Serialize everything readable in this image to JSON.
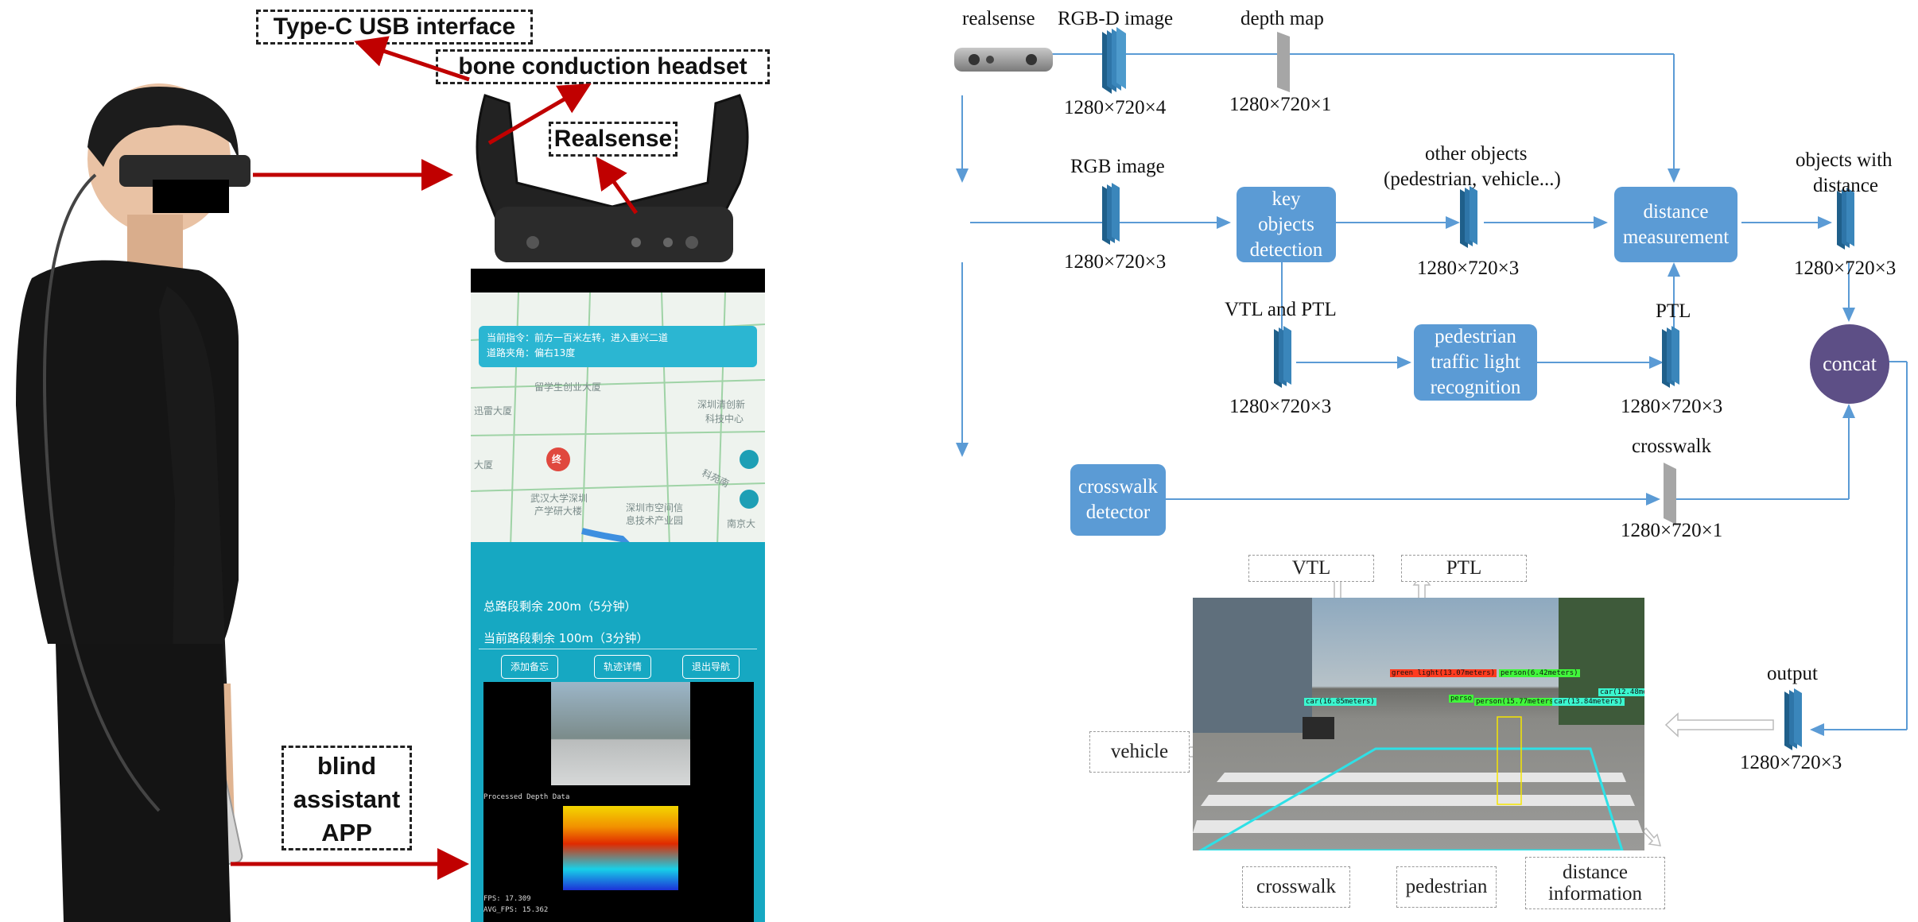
{
  "left_panel": {
    "callouts": {
      "typec": "Type-C USB interface",
      "bone": "bone conduction headset",
      "realsense": "Realsense",
      "app": [
        "blind",
        "assistant",
        "APP"
      ]
    },
    "phone": {
      "instruction_line1": "当前指令：前方一百米左转，进入重兴二道",
      "instruction_line2": "道路夹角：偏右13度",
      "map_labels": [
        "留学生创业大厦",
        "迅雷大厦",
        "深圳清创新",
        "科技中心",
        "武汉大学深圳",
        "产学研大楼",
        "深圳市空间信",
        "息技术产业园",
        "南京大",
        "科苑南",
        "大厦",
        "终"
      ],
      "remaining_total": "总路段剩余 200m（5分钟）",
      "remaining_current": "当前路段剩余 100m（3分钟）",
      "buttons": [
        "添加备忘",
        "轨迹详情",
        "退出导航"
      ],
      "depth_caption": "Processed Depth Data",
      "fps": "FPS: 17.309",
      "avg_fps": "AVG_FPS: 15.362"
    }
  },
  "diagram": {
    "labels": {
      "realsense": "realsense",
      "rgbd_image": "RGB-D image",
      "depth_map": "depth map",
      "rgbd_dim": "1280×720×4",
      "depth_dim": "1280×720×1",
      "rgb_image": "RGB image",
      "rgb_dim": "1280×720×3",
      "other_objects_1": "other objects",
      "other_objects_2": "(pedestrian, vehicle...)",
      "other_dim": "1280×720×3",
      "objects_with_distance_1": "objects with",
      "objects_with_distance_2": "distance",
      "obj_dist_dim": "1280×720×3",
      "vtl_ptl": "VTL and PTL",
      "vtl_ptl_dim": "1280×720×3",
      "ptl": "PTL",
      "ptl_dim": "1280×720×3",
      "crosswalk": "crosswalk",
      "crosswalk_dim": "1280×720×1",
      "output": "output",
      "output_dim": "1280×720×3"
    },
    "boxes": {
      "key_objects": [
        "key",
        "objects",
        "detection"
      ],
      "distance": [
        "distance",
        "measurement"
      ],
      "ptl_recog": [
        "pedestrian",
        "traffic light",
        "recognition"
      ],
      "crosswalk_det": [
        "crosswalk",
        "detector"
      ],
      "concat": "concat"
    },
    "result_tags": {
      "vtl": "VTL",
      "ptl": "PTL",
      "vehicle": "vehicle",
      "crosswalk": "crosswalk",
      "pedestrian": "pedestrian",
      "distance_info_1": "distance",
      "distance_info_2": "information"
    },
    "detections": [
      "green light(13.07meters)",
      "person(6.42meters)",
      "car(16.85meters)",
      "perso",
      "person(15.77meters)",
      "car(12.48me",
      "car(13.84meters)"
    ]
  },
  "colors": {
    "box_blue": "#5b9bd5",
    "concat_purple": "#5d4f86",
    "arrow_red": "#c00000",
    "line_blue": "#5b9bd5",
    "tensor_teal": "#2e75a8"
  }
}
